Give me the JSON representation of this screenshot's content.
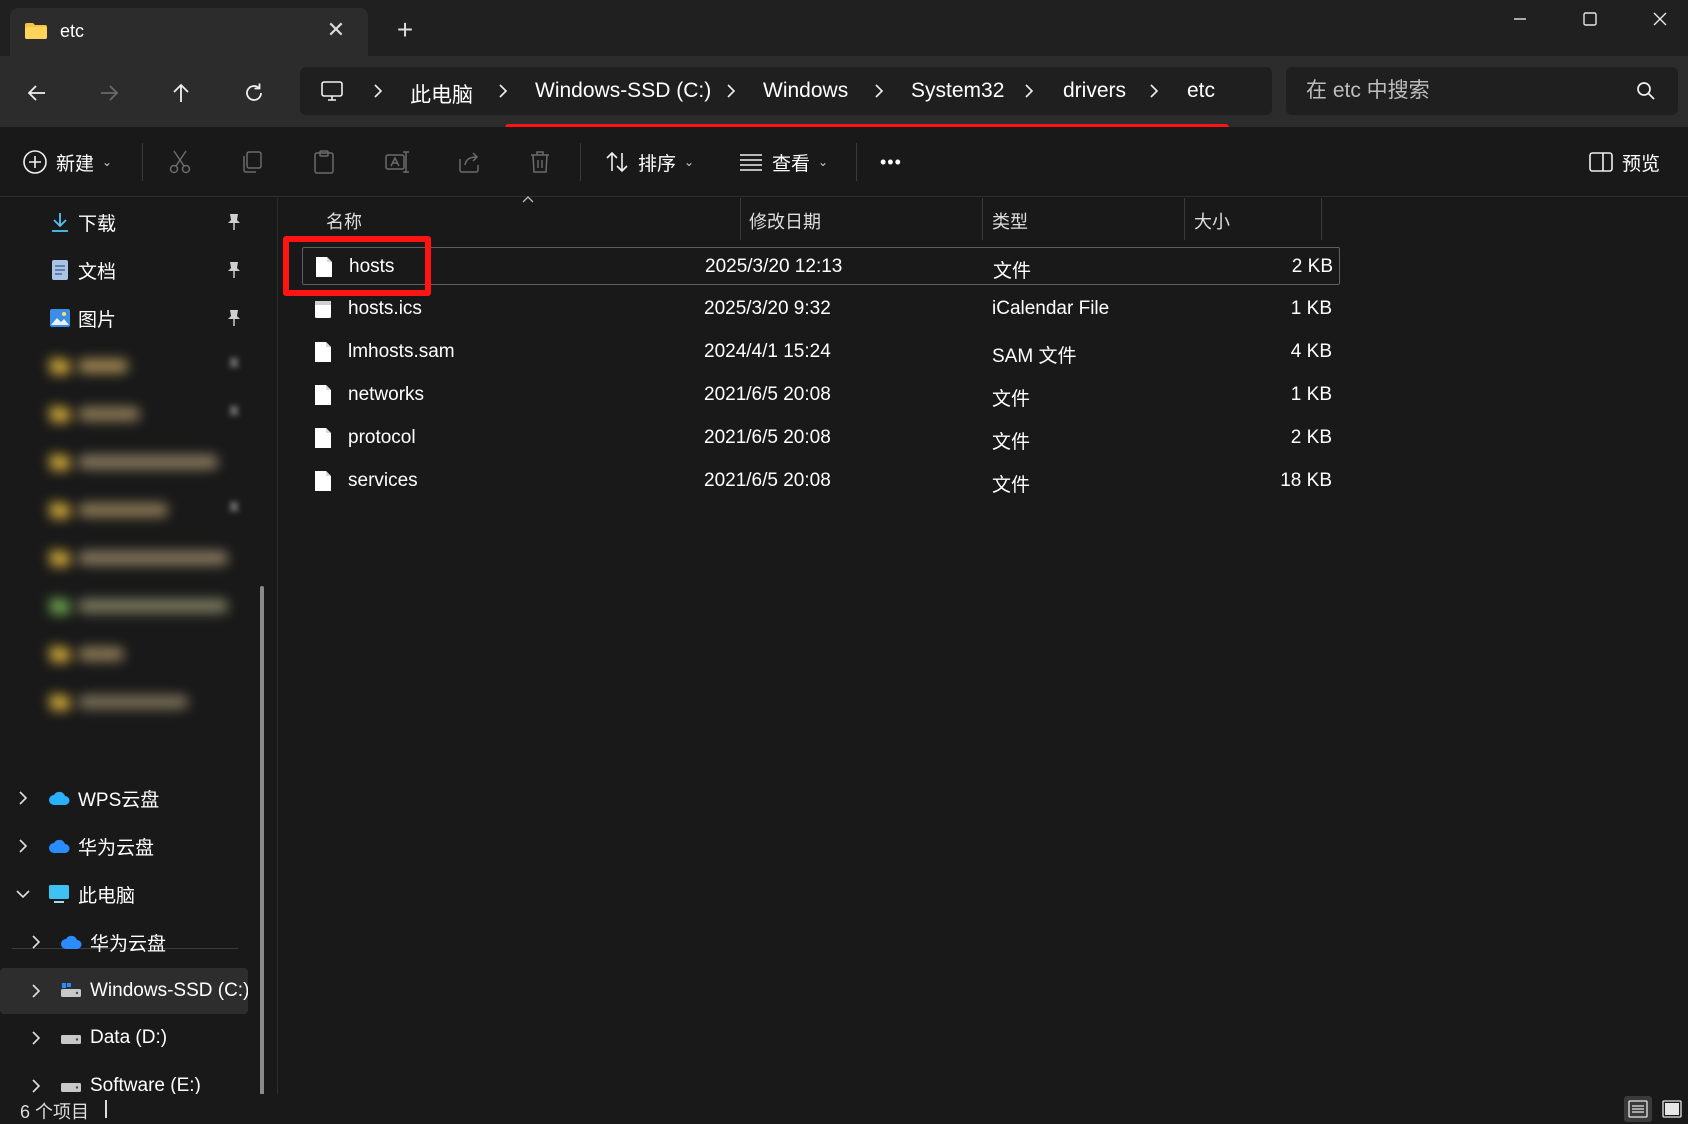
{
  "window": {
    "tab_title": "etc",
    "new_tab_symbol": "+"
  },
  "breadcrumb": [
    {
      "label": "此电脑"
    },
    {
      "label": "Windows-SSD (C:)"
    },
    {
      "label": "Windows"
    },
    {
      "label": "System32"
    },
    {
      "label": "drivers"
    },
    {
      "label": "etc"
    }
  ],
  "search": {
    "placeholder": "在 etc 中搜索"
  },
  "toolbar": {
    "new_label": "新建",
    "sort_label": "排序",
    "view_label": "查看",
    "more_label": "•••",
    "preview_label": "预览"
  },
  "sidebar": {
    "quick_access": [
      {
        "label": "下载",
        "icon": "download-icon",
        "pinned": true
      },
      {
        "label": "文档",
        "icon": "document-icon",
        "pinned": true
      },
      {
        "label": "图片",
        "icon": "pictures-icon",
        "pinned": true
      }
    ],
    "tree": [
      {
        "label": "WPS云盘",
        "icon": "cloud-icon",
        "expanded": false
      },
      {
        "label": "华为云盘",
        "icon": "cloud-icon",
        "expanded": false
      },
      {
        "label": "此电脑",
        "icon": "computer-icon",
        "expanded": true
      },
      {
        "label": "华为云盘",
        "icon": "cloud-icon",
        "expanded": false
      },
      {
        "label": "Windows-SSD (C:)",
        "icon": "drive-icon",
        "expanded": false,
        "selected": true
      },
      {
        "label": "Data (D:)",
        "icon": "drive-icon",
        "expanded": false
      },
      {
        "label": "Software (E:)",
        "icon": "drive-icon",
        "expanded": false
      }
    ]
  },
  "columns": {
    "name": "名称",
    "date": "修改日期",
    "type": "类型",
    "size": "大小"
  },
  "files": [
    {
      "name": "hosts",
      "date": "2025/3/20 12:13",
      "type": "文件",
      "size": "2 KB"
    },
    {
      "name": "hosts.ics",
      "date": "2025/3/20 9:32",
      "type": "iCalendar File",
      "size": "1 KB"
    },
    {
      "name": "lmhosts.sam",
      "date": "2024/4/1 15:24",
      "type": "SAM 文件",
      "size": "4 KB"
    },
    {
      "name": "networks",
      "date": "2021/6/5 20:08",
      "type": "文件",
      "size": "1 KB"
    },
    {
      "name": "protocol",
      "date": "2021/6/5 20:08",
      "type": "文件",
      "size": "2 KB"
    },
    {
      "name": "services",
      "date": "2021/6/5 20:08",
      "type": "文件",
      "size": "18 KB"
    }
  ],
  "status": {
    "item_count": "6 个项目"
  },
  "colors": {
    "background": "#191919",
    "chrome": "#2c2c2c",
    "annotation_red": "#ff1414",
    "folder_yellow": "#f4c542",
    "cloud_blue": "#2b8cff"
  }
}
